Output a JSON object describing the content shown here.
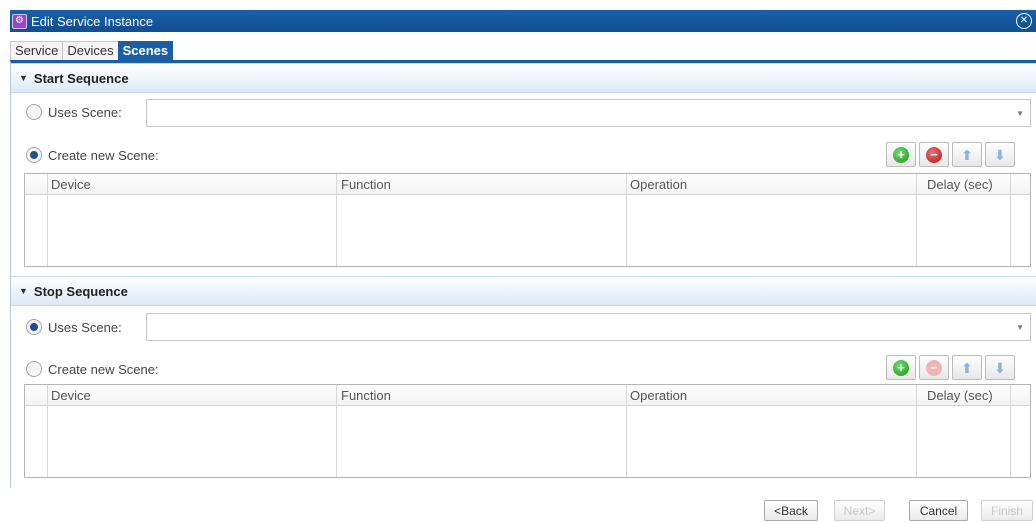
{
  "window": {
    "title": "Edit Service Instance",
    "icon": "app-icon",
    "close_icon": "close-circle-icon",
    "close_glyph": "✕"
  },
  "tabs": [
    {
      "label": "Service",
      "active": false
    },
    {
      "label": "Devices",
      "active": false
    },
    {
      "label": "Scenes",
      "active": true
    }
  ],
  "start_sequence": {
    "title": "Start Sequence",
    "uses_scene_label": "Uses Scene:",
    "uses_scene_checked": false,
    "uses_scene_value": "",
    "create_new_label": "Create new Scene:",
    "create_new_checked": true,
    "columns": [
      "Device",
      "Function",
      "Operation",
      "Delay (sec)"
    ],
    "rows": []
  },
  "stop_sequence": {
    "title": "Stop Sequence",
    "uses_scene_label": "Uses Scene:",
    "uses_scene_checked": true,
    "uses_scene_value": "",
    "create_new_label": "Create new Scene:",
    "create_new_checked": false,
    "columns": [
      "Device",
      "Function",
      "Operation",
      "Delay (sec)"
    ],
    "rows": []
  },
  "footer": {
    "back_label": "<Back",
    "next_label": "Next>",
    "cancel_label": "Cancel",
    "finish_label": "Finish"
  },
  "colors": {
    "accent": "#1a5fa6",
    "section_header": "#dce9f6"
  }
}
